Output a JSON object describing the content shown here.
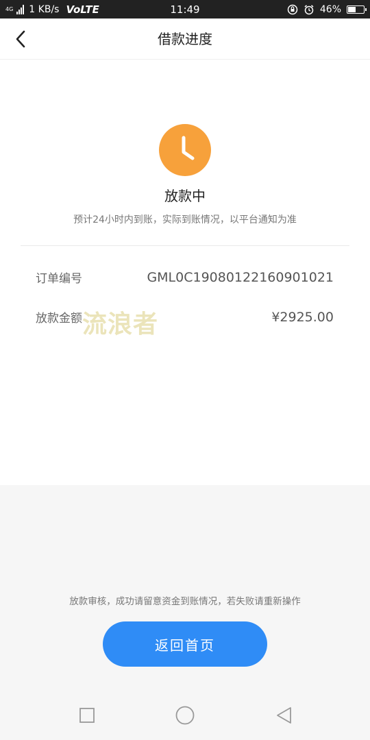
{
  "status_bar": {
    "network": "4G",
    "speed": "1 KB/s",
    "volte": "VoLTE",
    "time": "11:49",
    "battery": "46%",
    "battery_level": 0.46
  },
  "header": {
    "title": "借款进度",
    "back_icon": "chevron-left-icon"
  },
  "status": {
    "icon": "clock-icon",
    "title": "放款中",
    "subtitle": "预计24小时内到账，实际到账情况，以平台通知为准"
  },
  "details": [
    {
      "label": "订单编号",
      "value": "GML0C19080122160901021"
    },
    {
      "label": "放款金额",
      "value": "¥2925.00"
    }
  ],
  "watermark": "流浪者",
  "notice": "放款审核，成功请留意资金到账情况，若失败请重新操作",
  "home_button": {
    "label": "返回首页"
  },
  "colors": {
    "accent_orange": "#F7A13B",
    "accent_blue": "#2F8CF6",
    "statusbar_bg": "#222222"
  },
  "system_nav": {
    "recent": "square-icon",
    "home": "circle-icon",
    "back": "triangle-back-icon"
  }
}
